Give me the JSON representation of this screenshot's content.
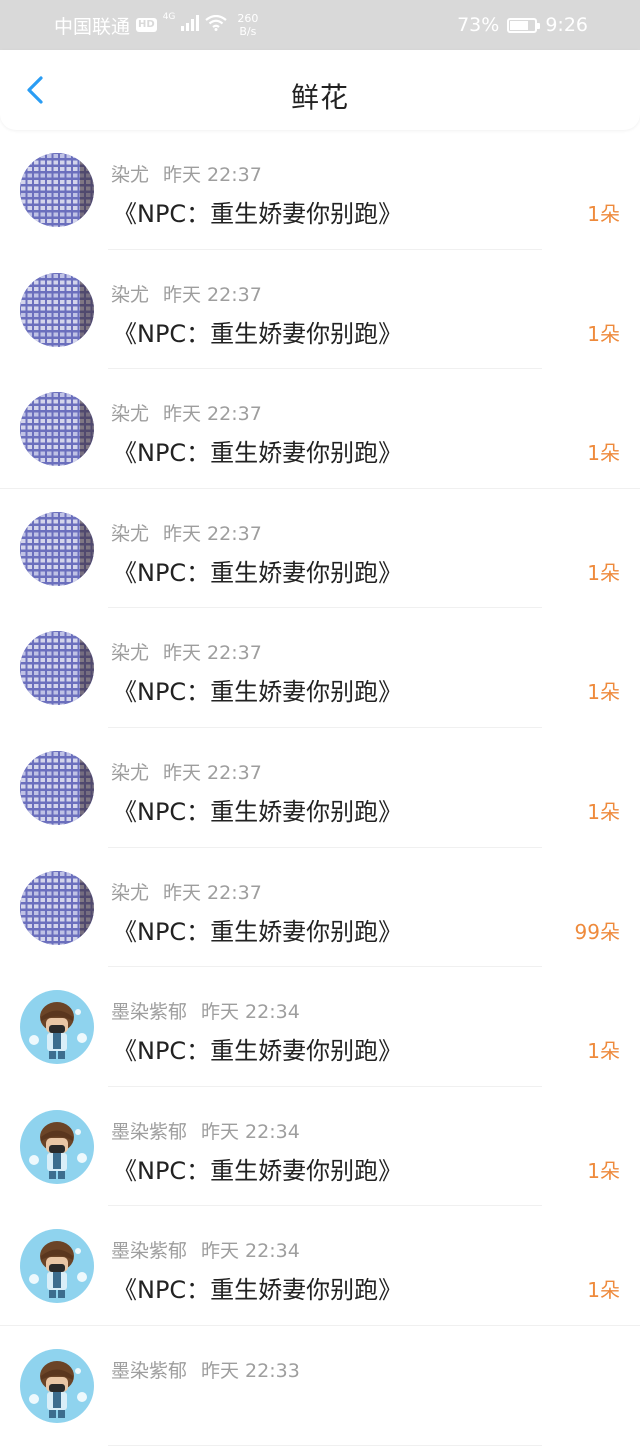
{
  "status_bar": {
    "carrier": "中国联通",
    "hd": "HD",
    "network": "4G",
    "speed_value": "260",
    "speed_unit": "B/s",
    "battery_text": "73%",
    "battery_level": 0.73,
    "time": "9:26"
  },
  "header": {
    "title": "鲜花",
    "back_icon": "chevron-left-icon",
    "accent_color": "#2a9df4"
  },
  "colors": {
    "count": "#ee8a3c",
    "meta": "#9e9e9e",
    "title_text": "#222222"
  },
  "items": [
    {
      "user": "染尤",
      "time": "昨天 22:37",
      "book": "《NPC：重生娇妻你别跑》",
      "count": "1朵",
      "avatar": "blue-pattern"
    },
    {
      "user": "染尤",
      "time": "昨天 22:37",
      "book": "《NPC：重生娇妻你别跑》",
      "count": "1朵",
      "avatar": "blue-pattern"
    },
    {
      "user": "染尤",
      "time": "昨天 22:37",
      "book": "《NPC：重生娇妻你别跑》",
      "count": "1朵",
      "avatar": "blue-pattern"
    },
    {
      "user": "染尤",
      "time": "昨天 22:37",
      "book": "《NPC：重生娇妻你别跑》",
      "count": "1朵",
      "avatar": "blue-pattern"
    },
    {
      "user": "染尤",
      "time": "昨天 22:37",
      "book": "《NPC：重生娇妻你别跑》",
      "count": "1朵",
      "avatar": "blue-pattern"
    },
    {
      "user": "染尤",
      "time": "昨天 22:37",
      "book": "《NPC：重生娇妻你别跑》",
      "count": "1朵",
      "avatar": "blue-pattern"
    },
    {
      "user": "染尤",
      "time": "昨天 22:37",
      "book": "《NPC：重生娇妻你别跑》",
      "count": "99朵",
      "avatar": "blue-pattern"
    },
    {
      "user": "墨染紫郁",
      "time": "昨天 22:34",
      "book": "《NPC：重生娇妻你别跑》",
      "count": "1朵",
      "avatar": "cartoon-character"
    },
    {
      "user": "墨染紫郁",
      "time": "昨天 22:34",
      "book": "《NPC：重生娇妻你别跑》",
      "count": "1朵",
      "avatar": "cartoon-character"
    },
    {
      "user": "墨染紫郁",
      "time": "昨天 22:34",
      "book": "《NPC：重生娇妻你别跑》",
      "count": "1朵",
      "avatar": "cartoon-character"
    },
    {
      "user": "墨染紫郁",
      "time": "昨天 22:33",
      "book": "",
      "count": "",
      "avatar": "cartoon-character"
    }
  ]
}
